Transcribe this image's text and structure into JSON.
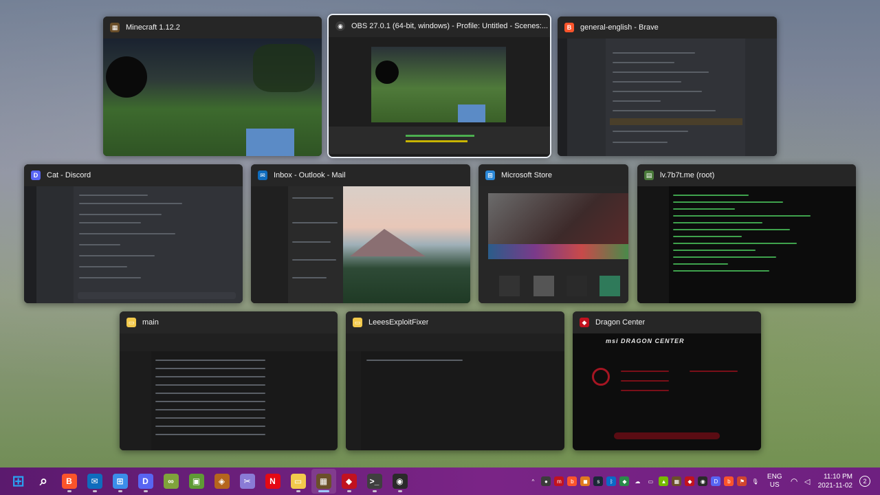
{
  "windows": [
    {
      "id": "minecraft",
      "title": "Minecraft 1.12.2",
      "icon": "minecraft-icon",
      "icon_color": "#6b4f2a",
      "focused": false
    },
    {
      "id": "obs",
      "title": "OBS 27.0.1 (64-bit, windows) - Profile: Untitled - Scenes:...",
      "icon": "obs-icon",
      "icon_color": "#3a3a3a",
      "focused": true
    },
    {
      "id": "brave",
      "title": "general-english - Brave",
      "icon": "brave-icon",
      "icon_color": "#fb542b",
      "focused": false
    },
    {
      "id": "discord",
      "title": "Cat - Discord",
      "icon": "discord-icon",
      "icon_color": "#5865f2",
      "focused": false
    },
    {
      "id": "outlook",
      "title": "Inbox - Outlook - Mail",
      "icon": "mail-icon",
      "icon_color": "#0f6cbd",
      "focused": false
    },
    {
      "id": "store",
      "title": "Microsoft Store",
      "icon": "store-icon",
      "icon_color": "#2b88d8",
      "focused": false
    },
    {
      "id": "terminal",
      "title": "lv.7b7t.me (root)",
      "icon": "terminal-icon",
      "icon_color": "#4a7a3a",
      "focused": false
    },
    {
      "id": "main",
      "title": "main",
      "icon": "folder-icon",
      "icon_color": "#f2c94c",
      "focused": false
    },
    {
      "id": "leees",
      "title": "LeeesExploitFixer",
      "icon": "folder-icon",
      "icon_color": "#f2c94c",
      "focused": false
    },
    {
      "id": "dragon",
      "title": "Dragon Center",
      "icon": "dragon-center-icon",
      "icon_color": "#c1121f",
      "focused": false
    }
  ],
  "dragon_center": {
    "logo": "msi DRAGON CENTER"
  },
  "taskbar": {
    "accent": "#6a1b7a",
    "apps": [
      {
        "name": "start-button",
        "glyph": "⊞",
        "color": "#2aa3f4",
        "running": false
      },
      {
        "name": "search-button",
        "glyph": "⌕",
        "color": "transparent",
        "running": false
      },
      {
        "name": "brave-taskbar",
        "glyph": "B",
        "color": "#fb542b",
        "running": true
      },
      {
        "name": "mail-taskbar",
        "glyph": "✉",
        "color": "#0f6cbd",
        "running": true
      },
      {
        "name": "store-taskbar",
        "glyph": "⊞",
        "color": "#3b8eea",
        "running": true
      },
      {
        "name": "discord-taskbar",
        "glyph": "D",
        "color": "#5865f2",
        "running": true
      },
      {
        "name": "infinity-app-taskbar",
        "glyph": "∞",
        "color": "#7fa33b",
        "running": false
      },
      {
        "name": "minecraft-launcher-taskbar",
        "glyph": "▣",
        "color": "#5f9a35",
        "running": false
      },
      {
        "name": "pattern-app-taskbar",
        "glyph": "◈",
        "color": "#b5651d",
        "running": false
      },
      {
        "name": "snip-taskbar",
        "glyph": "✂",
        "color": "#8a7bd6",
        "running": false
      },
      {
        "name": "netflix-taskbar",
        "glyph": "N",
        "color": "#e50914",
        "running": false
      },
      {
        "name": "file-explorer-taskbar",
        "glyph": "▭",
        "color": "#f2c94c",
        "running": true
      },
      {
        "name": "minecraft-taskbar",
        "glyph": "▦",
        "color": "#6b4f2a",
        "running": true,
        "active": true
      },
      {
        "name": "dragon-center-taskbar",
        "glyph": "◆",
        "color": "#c1121f",
        "running": true
      },
      {
        "name": "terminal-taskbar",
        "glyph": ">_",
        "color": "#3f3f3f",
        "running": true
      },
      {
        "name": "obs-taskbar",
        "glyph": "◉",
        "color": "#2a2a2a",
        "running": true
      }
    ],
    "tray": [
      {
        "name": "chevron-up-icon",
        "glyph": "^",
        "color": "transparent"
      },
      {
        "name": "xbox-icon",
        "glyph": "●",
        "color": "#3c3c3c"
      },
      {
        "name": "msi-tray-icon",
        "glyph": "m",
        "color": "#c1121f"
      },
      {
        "name": "brave-tray-icon",
        "glyph": "b",
        "color": "#fb542b"
      },
      {
        "name": "app-tray-icon",
        "glyph": "◼",
        "color": "#e07a1f"
      },
      {
        "name": "steam-icon",
        "glyph": "s",
        "color": "#1b2838"
      },
      {
        "name": "bluetooth-icon",
        "glyph": "ᛒ",
        "color": "#0b69c7"
      },
      {
        "name": "shield-icon",
        "glyph": "◆",
        "color": "#2a8a4a"
      },
      {
        "name": "onedrive-icon",
        "glyph": "☁",
        "color": "transparent"
      },
      {
        "name": "display-icon",
        "glyph": "▭",
        "color": "transparent"
      },
      {
        "name": "nvidia-icon",
        "glyph": "▲",
        "color": "#76b900"
      },
      {
        "name": "minecraft-tray-icon",
        "glyph": "▦",
        "color": "#6b4f2a"
      },
      {
        "name": "dragon-tray-icon",
        "glyph": "◆",
        "color": "#c1121f"
      },
      {
        "name": "obs-tray-icon",
        "glyph": "◉",
        "color": "#2a2a2a"
      },
      {
        "name": "discord-tray-icon",
        "glyph": "D",
        "color": "#5865f2"
      },
      {
        "name": "brave-tray-icon-2",
        "glyph": "b",
        "color": "#fb542b"
      },
      {
        "name": "flag-icon",
        "glyph": "⚑",
        "color": "#d1452f"
      },
      {
        "name": "microphone-icon",
        "glyph": "🎙",
        "color": "transparent"
      }
    ],
    "language": {
      "line1": "ENG",
      "line2": "US"
    },
    "clock": {
      "time": "11:10 PM",
      "date": "2021-11-02"
    },
    "notifications": "2"
  }
}
